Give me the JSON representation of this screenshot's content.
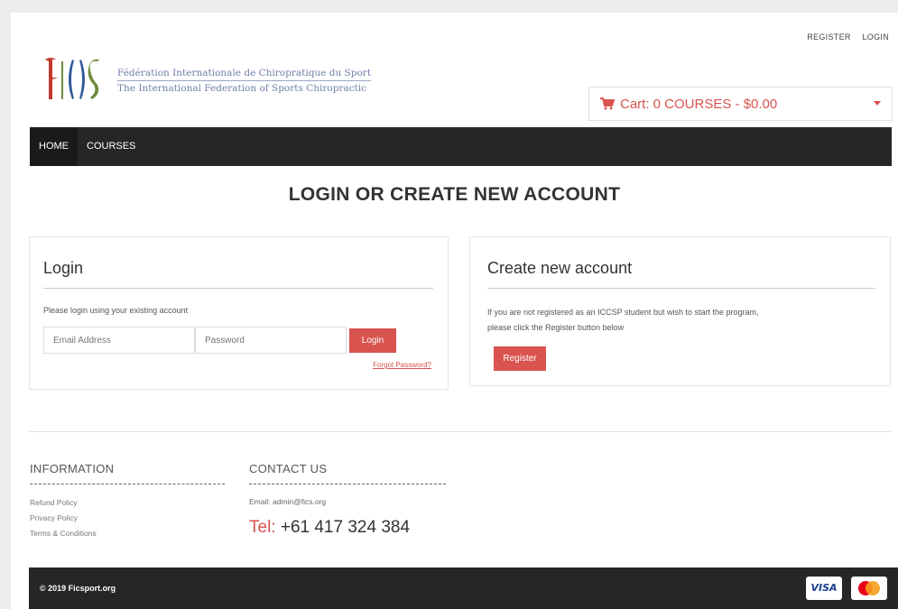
{
  "topbar": {
    "register": "REGISTER",
    "login": "LOGIN"
  },
  "logo": {
    "line1": "Fédération Internationale de Chiropratique du Sport",
    "line2": "The International Federation of Sports Chiropractic"
  },
  "cart": {
    "label": "Cart: 0 COURSES - $0.00",
    "icon": "cart-icon"
  },
  "nav": {
    "items": [
      "HOME",
      "COURSES"
    ]
  },
  "page_title": "LOGIN OR CREATE NEW ACCOUNT",
  "login": {
    "heading": "Login",
    "hint": "Please login using your existing account",
    "email_placeholder": "Email Address",
    "password_placeholder": "Password",
    "button": "Login",
    "forgot": "Forgot Password?"
  },
  "create": {
    "heading": "Create new account",
    "desc_line1": "If you are not registered as an ICCSP student but wish to start the program,",
    "desc_line2": "please click the Register button below",
    "button": "Register"
  },
  "footer": {
    "info_heading": "INFORMATION",
    "info_links": [
      "Refund Policy",
      "Privacy Policy",
      "Terms & Conditions"
    ],
    "contact_heading": "CONTACT US",
    "email": "Email: admin@fics.org",
    "tel_label": "Tel:",
    "tel_number": "+61 417 324 384",
    "copyright": "© 2019 Ficsport.org",
    "cards": [
      "VISA",
      "mastercard"
    ]
  },
  "colors": {
    "accent": "#d9534f",
    "nav_bg": "#262626",
    "logo_text": "#6f7fa8"
  }
}
